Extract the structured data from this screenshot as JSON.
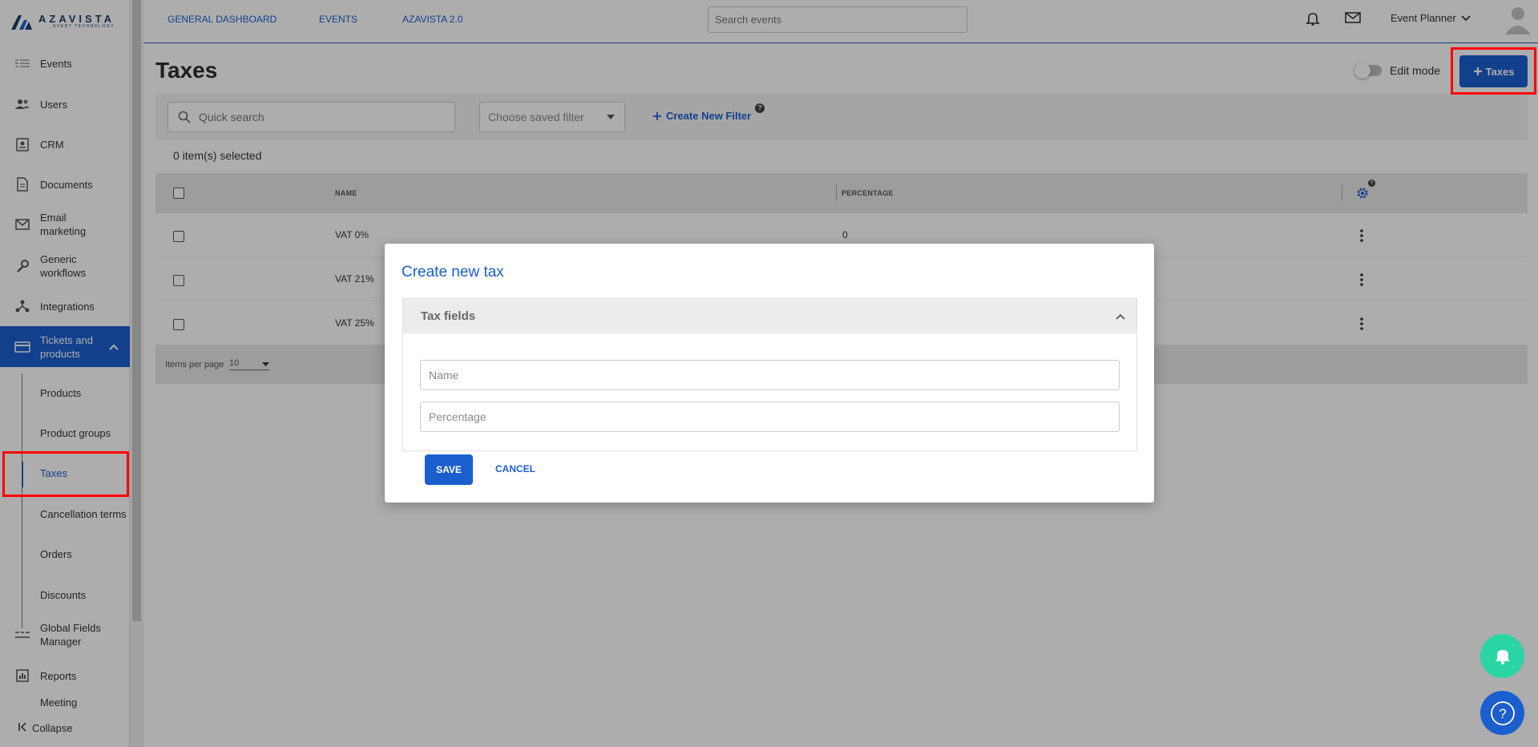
{
  "brand": {
    "name": "AZAVISTA",
    "tagline": "EVENT TECHNOLOGY"
  },
  "topnav": {
    "links": [
      "GENERAL DASHBOARD",
      "EVENTS",
      "AZAVISTA 2.0"
    ],
    "search_placeholder": "Search events",
    "user_role": "Event Planner"
  },
  "sidebar": {
    "items": [
      {
        "label": "Events",
        "icon": "events-icon"
      },
      {
        "label": "Users",
        "icon": "users-icon"
      },
      {
        "label": "CRM",
        "icon": "crm-icon"
      },
      {
        "label": "Documents",
        "icon": "documents-icon"
      },
      {
        "label": "Email\nmarketing",
        "icon": "email-icon"
      },
      {
        "label": "Generic\nworkflows",
        "icon": "wrench-icon"
      },
      {
        "label": "Integrations",
        "icon": "integrations-icon"
      },
      {
        "label": "Tickets and\nproducts",
        "icon": "card-icon"
      },
      {
        "label": "Global Fields\nManager",
        "icon": "fields-icon"
      },
      {
        "label": "Reports",
        "icon": "reports-icon"
      },
      {
        "label": "Meeting",
        "icon": ""
      }
    ],
    "sub_items": [
      "Products",
      "Product groups",
      "Taxes",
      "Cancellation terms",
      "Orders",
      "Discounts"
    ],
    "collapse_label": "Collapse"
  },
  "page": {
    "title": "Taxes",
    "edit_mode_label": "Edit mode",
    "add_button_label": "Taxes",
    "quick_search_placeholder": "Quick search",
    "saved_filter_placeholder": "Choose saved filter",
    "create_filter_label": "Create New Filter",
    "selected_count": "0 item(s) selected"
  },
  "table": {
    "columns": [
      "NAME",
      "PERCENTAGE"
    ],
    "rows": [
      {
        "name": "VAT 0%",
        "percentage": "0"
      },
      {
        "name": "VAT 21%",
        "percentage": ""
      },
      {
        "name": "VAT 25%",
        "percentage": ""
      }
    ],
    "items_per_page_label": "Items per page",
    "items_per_page_value": "10"
  },
  "modal": {
    "title": "Create new tax",
    "section_title": "Tax fields",
    "name_placeholder": "Name",
    "percentage_placeholder": "Percentage",
    "save_label": "SAVE",
    "cancel_label": "CANCEL"
  },
  "colors": {
    "accent": "#1b5fcf",
    "highlight": "#ff0000",
    "fab_green": "#2bd4a4"
  }
}
